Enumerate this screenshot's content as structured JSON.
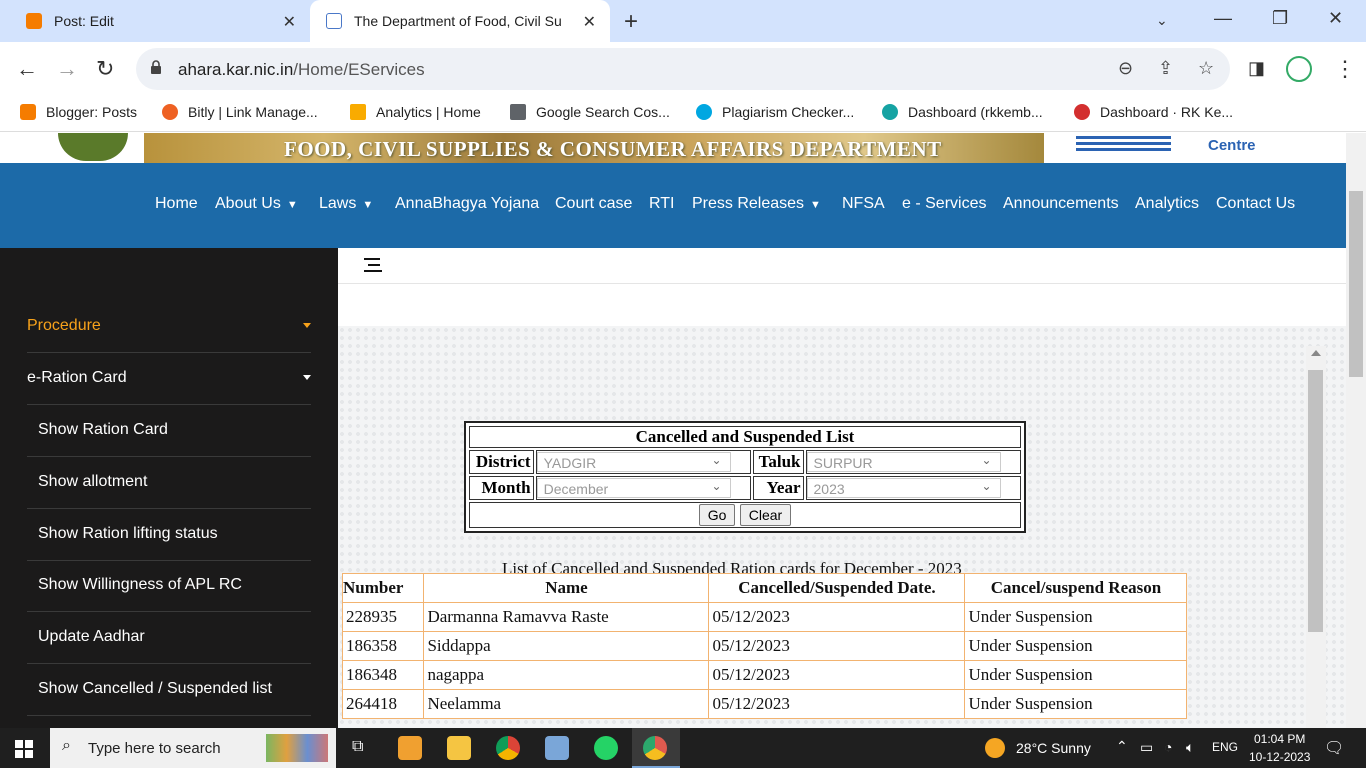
{
  "browser": {
    "tabs": [
      {
        "title": "Post: Edit",
        "favicon_color": "#f57c00"
      },
      {
        "title": "The Department of Food, Civil Su",
        "favicon_color": "#4a78c8"
      }
    ],
    "url_host": "ahara.kar.nic.in",
    "url_path": "/Home/EServices",
    "bookmarks": [
      {
        "label": "Blogger: Posts",
        "color": "#f57c00"
      },
      {
        "label": "Bitly | Link Manage...",
        "color": "#ee6123"
      },
      {
        "label": "Analytics | Home",
        "color": "#f9ab00"
      },
      {
        "label": "Google Search Cos...",
        "color": "#5f6368"
      },
      {
        "label": "Plagiarism Checker...",
        "color": "#00a7e1"
      },
      {
        "label": "Dashboard (rkkemb...",
        "color": "#16a3a3"
      },
      {
        "label": "Dashboard · RK Ke...",
        "color": "#d32f2f"
      }
    ]
  },
  "banner": {
    "department": "FOOD, CIVIL SUPPLIES & CONSUMER AFFAIRS DEPARTMENT",
    "nic_text": "Centre"
  },
  "nav": {
    "items": [
      {
        "label": "Home",
        "dropdown": false
      },
      {
        "label": "About Us",
        "dropdown": true
      },
      {
        "label": "Laws",
        "dropdown": true
      },
      {
        "label": "AnnaBhagya Yojana",
        "dropdown": false
      },
      {
        "label": "Court case",
        "dropdown": false
      },
      {
        "label": "RTI",
        "dropdown": false
      },
      {
        "label": "Press Releases",
        "dropdown": true
      },
      {
        "label": "NFSA",
        "dropdown": false
      },
      {
        "label": "e - Services",
        "dropdown": false
      },
      {
        "label": "Announcements",
        "dropdown": false
      },
      {
        "label": "Analytics",
        "dropdown": false
      },
      {
        "label": "Contact Us",
        "dropdown": false
      }
    ]
  },
  "sidebar": {
    "items": [
      {
        "label": "Procedure"
      },
      {
        "label": "e-Ration Card"
      },
      {
        "label": "Show Ration Card"
      },
      {
        "label": "Show allotment"
      },
      {
        "label": "Show Ration lifting status"
      },
      {
        "label": "Show Willingness of APL RC"
      },
      {
        "label": "Update Aadhar"
      },
      {
        "label": "Show Cancelled / Suspended list"
      }
    ]
  },
  "form": {
    "title": "Cancelled and Suspended List",
    "district_label": "District",
    "district_value": "YADGIR",
    "taluk_label": "Taluk",
    "taluk_value": "SURPUR",
    "month_label": "Month",
    "month_value": "December",
    "year_label": "Year",
    "year_value": "2023",
    "go_label": "Go",
    "clear_label": "Clear"
  },
  "list": {
    "title": "List of Cancelled and Suspended Ration cards for December - 2023",
    "columns": [
      "Number",
      "Name",
      "Cancelled/Suspended Date.",
      "Cancel/suspend Reason"
    ],
    "rows": [
      [
        "228935",
        "Darmanna Ramavva Raste",
        "05/12/2023",
        "Under Suspension"
      ],
      [
        "186358",
        "Siddappa",
        "05/12/2023",
        "Under Suspension"
      ],
      [
        "186348",
        "nagappa",
        "05/12/2023",
        "Under Suspension"
      ],
      [
        "264418",
        "Neelamma",
        "05/12/2023",
        "Under Suspension"
      ]
    ]
  },
  "taskbar": {
    "search_placeholder": "Type here to search",
    "weather": "28°C  Sunny",
    "language": "ENG",
    "time": "01:04 PM",
    "date": "10-12-2023"
  }
}
